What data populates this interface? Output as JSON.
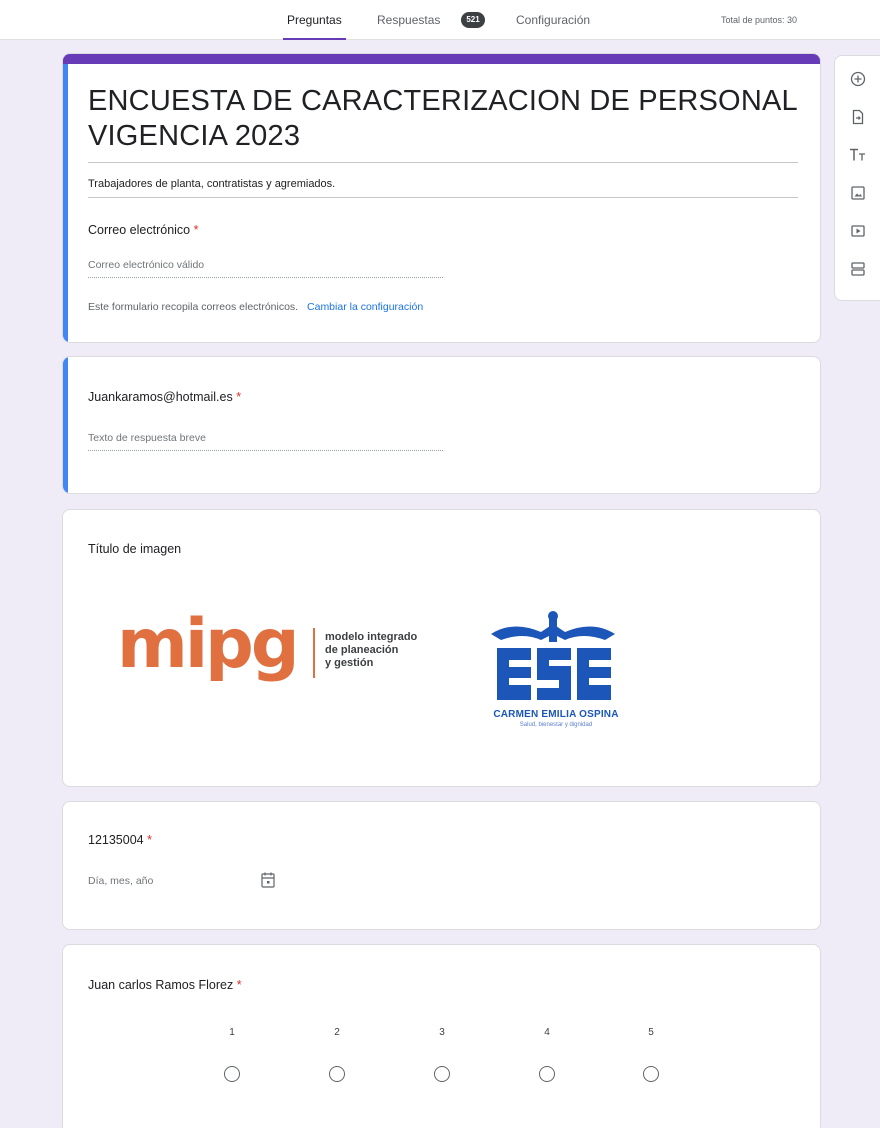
{
  "tabs": {
    "questions": "Preguntas",
    "responses": "Respuestas",
    "responses_count": "521",
    "settings": "Configuración"
  },
  "total_points": "Total de puntos: 30",
  "form": {
    "title": "ENCUESTA DE CARACTERIZACION DE PERSONAL VIGENCIA 2023",
    "description": "Trabajadores de planta, contratistas y agremiados.",
    "email_question": "Correo electrónico",
    "email_placeholder": "Correo electrónico válido",
    "collect_note": "Este formulario recopila correos electrónicos.",
    "change_settings": "Cambiar la configuración"
  },
  "questions": {
    "q1_title": "Juankaramos@hotmail.es",
    "q1_placeholder": "Texto de respuesta breve",
    "image_title": "Título de imagen",
    "date_title": "12135004",
    "date_placeholder": "Día, mes, año",
    "scale_title": "Juan carlos Ramos Florez",
    "scale_values": [
      "1",
      "2",
      "3",
      "4",
      "5"
    ]
  },
  "logos": {
    "mipg_mark": "mipg",
    "mipg_line1": "modelo integrado",
    "mipg_line2": "de planeación",
    "mipg_line3": "y gestión",
    "ese_mark": "ESE",
    "ese_name": "CARMEN EMILIA OSPINA",
    "ese_tagline": "Salud, bienestar y dignidad"
  },
  "required_marker": "*",
  "colors": {
    "theme": "#673ab7",
    "selected_bar": "#4285f4",
    "background": "#efebf7",
    "required": "#d93025",
    "link": "#1a73e8",
    "mipg_orange": "#e07040",
    "ese_blue": "#1b56b8"
  },
  "toolbar_icons": [
    "add-question-icon",
    "import-questions-icon",
    "add-title-icon",
    "add-image-icon",
    "add-video-icon",
    "add-section-icon"
  ]
}
